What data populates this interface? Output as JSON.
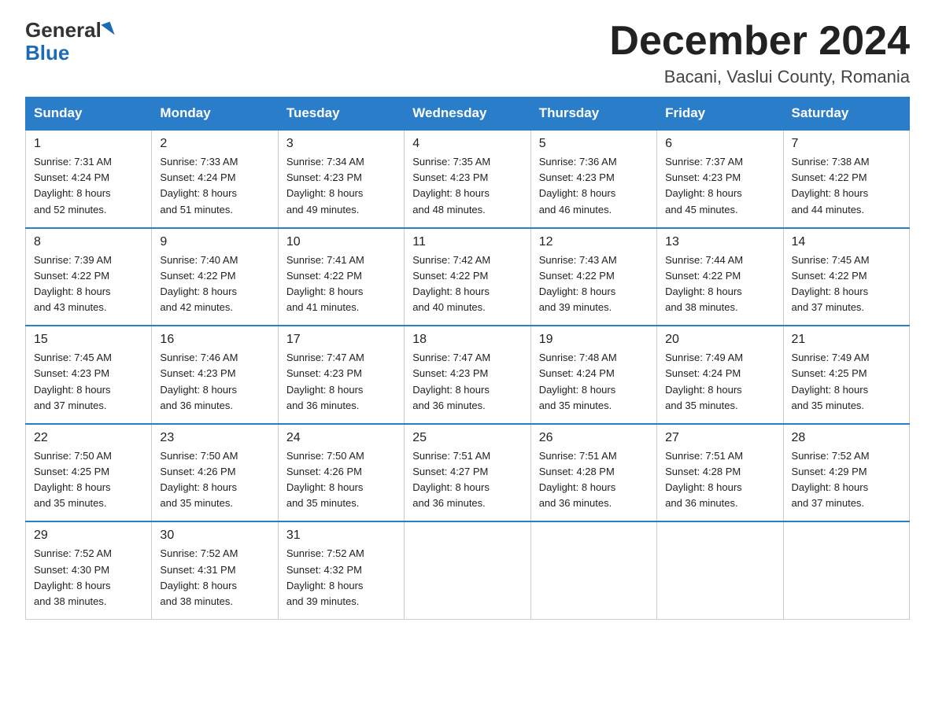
{
  "logo": {
    "part1": "General",
    "part2": "Blue"
  },
  "header": {
    "title": "December 2024",
    "subtitle": "Bacani, Vaslui County, Romania"
  },
  "days_of_week": [
    "Sunday",
    "Monday",
    "Tuesday",
    "Wednesday",
    "Thursday",
    "Friday",
    "Saturday"
  ],
  "weeks": [
    [
      {
        "day": "1",
        "sunrise": "7:31 AM",
        "sunset": "4:24 PM",
        "daylight": "8 hours and 52 minutes."
      },
      {
        "day": "2",
        "sunrise": "7:33 AM",
        "sunset": "4:24 PM",
        "daylight": "8 hours and 51 minutes."
      },
      {
        "day": "3",
        "sunrise": "7:34 AM",
        "sunset": "4:23 PM",
        "daylight": "8 hours and 49 minutes."
      },
      {
        "day": "4",
        "sunrise": "7:35 AM",
        "sunset": "4:23 PM",
        "daylight": "8 hours and 48 minutes."
      },
      {
        "day": "5",
        "sunrise": "7:36 AM",
        "sunset": "4:23 PM",
        "daylight": "8 hours and 46 minutes."
      },
      {
        "day": "6",
        "sunrise": "7:37 AM",
        "sunset": "4:23 PM",
        "daylight": "8 hours and 45 minutes."
      },
      {
        "day": "7",
        "sunrise": "7:38 AM",
        "sunset": "4:22 PM",
        "daylight": "8 hours and 44 minutes."
      }
    ],
    [
      {
        "day": "8",
        "sunrise": "7:39 AM",
        "sunset": "4:22 PM",
        "daylight": "8 hours and 43 minutes."
      },
      {
        "day": "9",
        "sunrise": "7:40 AM",
        "sunset": "4:22 PM",
        "daylight": "8 hours and 42 minutes."
      },
      {
        "day": "10",
        "sunrise": "7:41 AM",
        "sunset": "4:22 PM",
        "daylight": "8 hours and 41 minutes."
      },
      {
        "day": "11",
        "sunrise": "7:42 AM",
        "sunset": "4:22 PM",
        "daylight": "8 hours and 40 minutes."
      },
      {
        "day": "12",
        "sunrise": "7:43 AM",
        "sunset": "4:22 PM",
        "daylight": "8 hours and 39 minutes."
      },
      {
        "day": "13",
        "sunrise": "7:44 AM",
        "sunset": "4:22 PM",
        "daylight": "8 hours and 38 minutes."
      },
      {
        "day": "14",
        "sunrise": "7:45 AM",
        "sunset": "4:22 PM",
        "daylight": "8 hours and 37 minutes."
      }
    ],
    [
      {
        "day": "15",
        "sunrise": "7:45 AM",
        "sunset": "4:23 PM",
        "daylight": "8 hours and 37 minutes."
      },
      {
        "day": "16",
        "sunrise": "7:46 AM",
        "sunset": "4:23 PM",
        "daylight": "8 hours and 36 minutes."
      },
      {
        "day": "17",
        "sunrise": "7:47 AM",
        "sunset": "4:23 PM",
        "daylight": "8 hours and 36 minutes."
      },
      {
        "day": "18",
        "sunrise": "7:47 AM",
        "sunset": "4:23 PM",
        "daylight": "8 hours and 36 minutes."
      },
      {
        "day": "19",
        "sunrise": "7:48 AM",
        "sunset": "4:24 PM",
        "daylight": "8 hours and 35 minutes."
      },
      {
        "day": "20",
        "sunrise": "7:49 AM",
        "sunset": "4:24 PM",
        "daylight": "8 hours and 35 minutes."
      },
      {
        "day": "21",
        "sunrise": "7:49 AM",
        "sunset": "4:25 PM",
        "daylight": "8 hours and 35 minutes."
      }
    ],
    [
      {
        "day": "22",
        "sunrise": "7:50 AM",
        "sunset": "4:25 PM",
        "daylight": "8 hours and 35 minutes."
      },
      {
        "day": "23",
        "sunrise": "7:50 AM",
        "sunset": "4:26 PM",
        "daylight": "8 hours and 35 minutes."
      },
      {
        "day": "24",
        "sunrise": "7:50 AM",
        "sunset": "4:26 PM",
        "daylight": "8 hours and 35 minutes."
      },
      {
        "day": "25",
        "sunrise": "7:51 AM",
        "sunset": "4:27 PM",
        "daylight": "8 hours and 36 minutes."
      },
      {
        "day": "26",
        "sunrise": "7:51 AM",
        "sunset": "4:28 PM",
        "daylight": "8 hours and 36 minutes."
      },
      {
        "day": "27",
        "sunrise": "7:51 AM",
        "sunset": "4:28 PM",
        "daylight": "8 hours and 36 minutes."
      },
      {
        "day": "28",
        "sunrise": "7:52 AM",
        "sunset": "4:29 PM",
        "daylight": "8 hours and 37 minutes."
      }
    ],
    [
      {
        "day": "29",
        "sunrise": "7:52 AM",
        "sunset": "4:30 PM",
        "daylight": "8 hours and 38 minutes."
      },
      {
        "day": "30",
        "sunrise": "7:52 AM",
        "sunset": "4:31 PM",
        "daylight": "8 hours and 38 minutes."
      },
      {
        "day": "31",
        "sunrise": "7:52 AM",
        "sunset": "4:32 PM",
        "daylight": "8 hours and 39 minutes."
      },
      null,
      null,
      null,
      null
    ]
  ],
  "labels": {
    "sunrise": "Sunrise:",
    "sunset": "Sunset:",
    "daylight": "Daylight:"
  }
}
